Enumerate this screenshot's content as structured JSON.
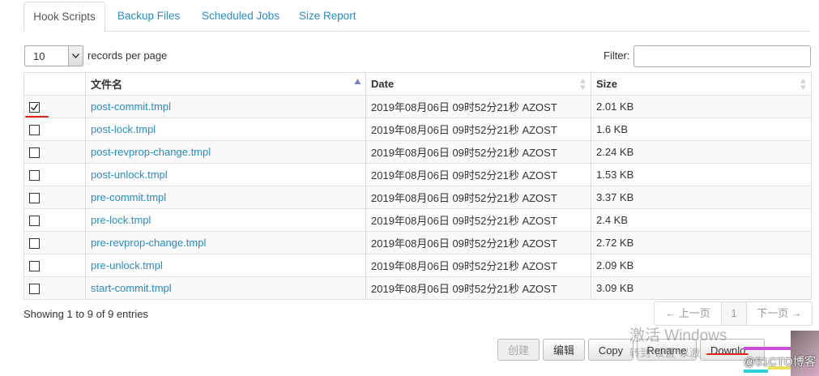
{
  "tabs": [
    {
      "label": "Hook Scripts",
      "active": true
    },
    {
      "label": "Backup Files",
      "active": false
    },
    {
      "label": "Scheduled Jobs",
      "active": false
    },
    {
      "label": "Size Report",
      "active": false
    }
  ],
  "length": {
    "value": "10",
    "label": "records per page"
  },
  "filter": {
    "label": "Filter:",
    "value": ""
  },
  "table": {
    "columns": {
      "name": "文件名",
      "date": "Date",
      "size": "Size"
    },
    "rows": [
      {
        "checked": true,
        "name": "post-commit.tmpl",
        "date": "2019年08月06日 09时52分21秒 AZOST",
        "size": "2.01 KB"
      },
      {
        "checked": false,
        "name": "post-lock.tmpl",
        "date": "2019年08月06日 09时52分21秒 AZOST",
        "size": "1.6 KB"
      },
      {
        "checked": false,
        "name": "post-revprop-change.tmpl",
        "date": "2019年08月06日 09时52分21秒 AZOST",
        "size": "2.24 KB"
      },
      {
        "checked": false,
        "name": "post-unlock.tmpl",
        "date": "2019年08月06日 09时52分21秒 AZOST",
        "size": "1.53 KB"
      },
      {
        "checked": false,
        "name": "pre-commit.tmpl",
        "date": "2019年08月06日 09时52分21秒 AZOST",
        "size": "3.37 KB"
      },
      {
        "checked": false,
        "name": "pre-lock.tmpl",
        "date": "2019年08月06日 09时52分21秒 AZOST",
        "size": "2.4 KB"
      },
      {
        "checked": false,
        "name": "pre-revprop-change.tmpl",
        "date": "2019年08月06日 09时52分21秒 AZOST",
        "size": "2.72 KB"
      },
      {
        "checked": false,
        "name": "pre-unlock.tmpl",
        "date": "2019年08月06日 09时52分21秒 AZOST",
        "size": "2.09 KB"
      },
      {
        "checked": false,
        "name": "start-commit.tmpl",
        "date": "2019年08月06日 09时52分21秒 AZOST",
        "size": "3.09 KB"
      }
    ]
  },
  "info": "Showing 1 to 9 of 9 entries",
  "pagination": {
    "prev": "← 上一页",
    "current": "1",
    "next": "下一页 →"
  },
  "actions": {
    "create": "创建",
    "edit": "编辑",
    "copy": "Copy",
    "rename": "Rename",
    "download": "Downlo"
  },
  "watermark": {
    "windows_title": "激活 Windows",
    "windows_sub": "转到\"设置\"以激",
    "site": "@51CTO博客"
  },
  "colors": {
    "link": "#2a8cc2",
    "annotation_red": "#e3231b",
    "border": "#dddddd",
    "stripe": "#f9f9f9"
  },
  "icons": {
    "sort_asc": "triangle-up",
    "sort_both": "double-triangle",
    "select_arrow": "chevron-down",
    "checkbox_checked": "checkmark"
  }
}
